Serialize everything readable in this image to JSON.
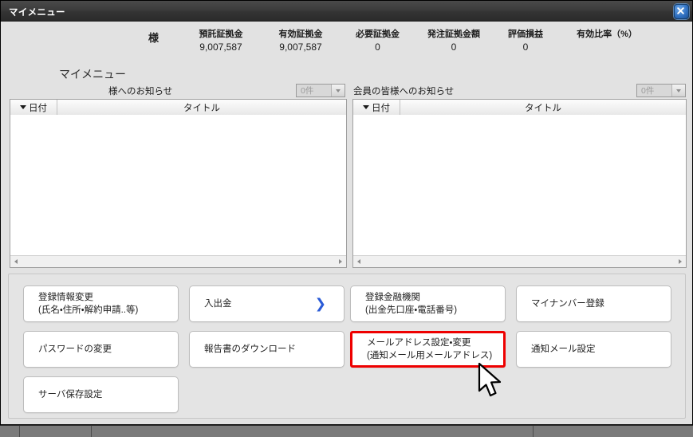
{
  "window": {
    "title": "マイメニュー",
    "close_label": "×"
  },
  "summary": {
    "honorific": "様",
    "metrics": [
      {
        "label": "預託証拠金",
        "value": "9,007,587"
      },
      {
        "label": "有効証拠金",
        "value": "9,007,587"
      },
      {
        "label": "必要証拠金",
        "value": "0"
      },
      {
        "label": "発注証拠金額",
        "value": "0"
      },
      {
        "label": "評価損益",
        "value": "0"
      },
      {
        "label": "有効比率（%）",
        "value": ""
      }
    ]
  },
  "page_title": "マイメニュー",
  "notices": {
    "personal": {
      "label": "様へのお知らせ",
      "count_value": "0件",
      "columns": {
        "date": "日付",
        "title": "タイトル"
      }
    },
    "members": {
      "label": "会員の皆様へのお知らせ",
      "count_value": "0件",
      "columns": {
        "date": "日付",
        "title": "タイトル"
      }
    }
  },
  "menu_buttons": [
    {
      "line1": "登録情報変更",
      "line2": "(氏名・住所・解約申請..等)",
      "chevron": "",
      "highlight": false
    },
    {
      "line1": "入出金",
      "line2": "",
      "chevron": "❯",
      "highlight": false
    },
    {
      "line1": "登録金融機関",
      "line2": "(出金先口座・電話番号)",
      "chevron": "",
      "highlight": false
    },
    {
      "line1": "マイナンバー登録",
      "line2": "",
      "chevron": "",
      "highlight": false
    },
    {
      "line1": "パスワードの変更",
      "line2": "",
      "chevron": "",
      "highlight": false
    },
    {
      "line1": "報告書のダウンロード",
      "line2": "",
      "chevron": "",
      "highlight": false
    },
    {
      "line1": "メールアドレス設定・変更",
      "line2": "(通知メール用メールアドレス)",
      "chevron": "",
      "highlight": true
    },
    {
      "line1": "通知メール設定",
      "line2": "",
      "chevron": "",
      "highlight": false
    },
    {
      "line1": "サーバ保存設定",
      "line2": "",
      "chevron": "",
      "highlight": false
    }
  ],
  "colors": {
    "highlight_border": "#ee0000",
    "chevron_blue": "#2a5bd7",
    "titlebar": "#343434",
    "panel_bg": "#e2e2e2"
  }
}
